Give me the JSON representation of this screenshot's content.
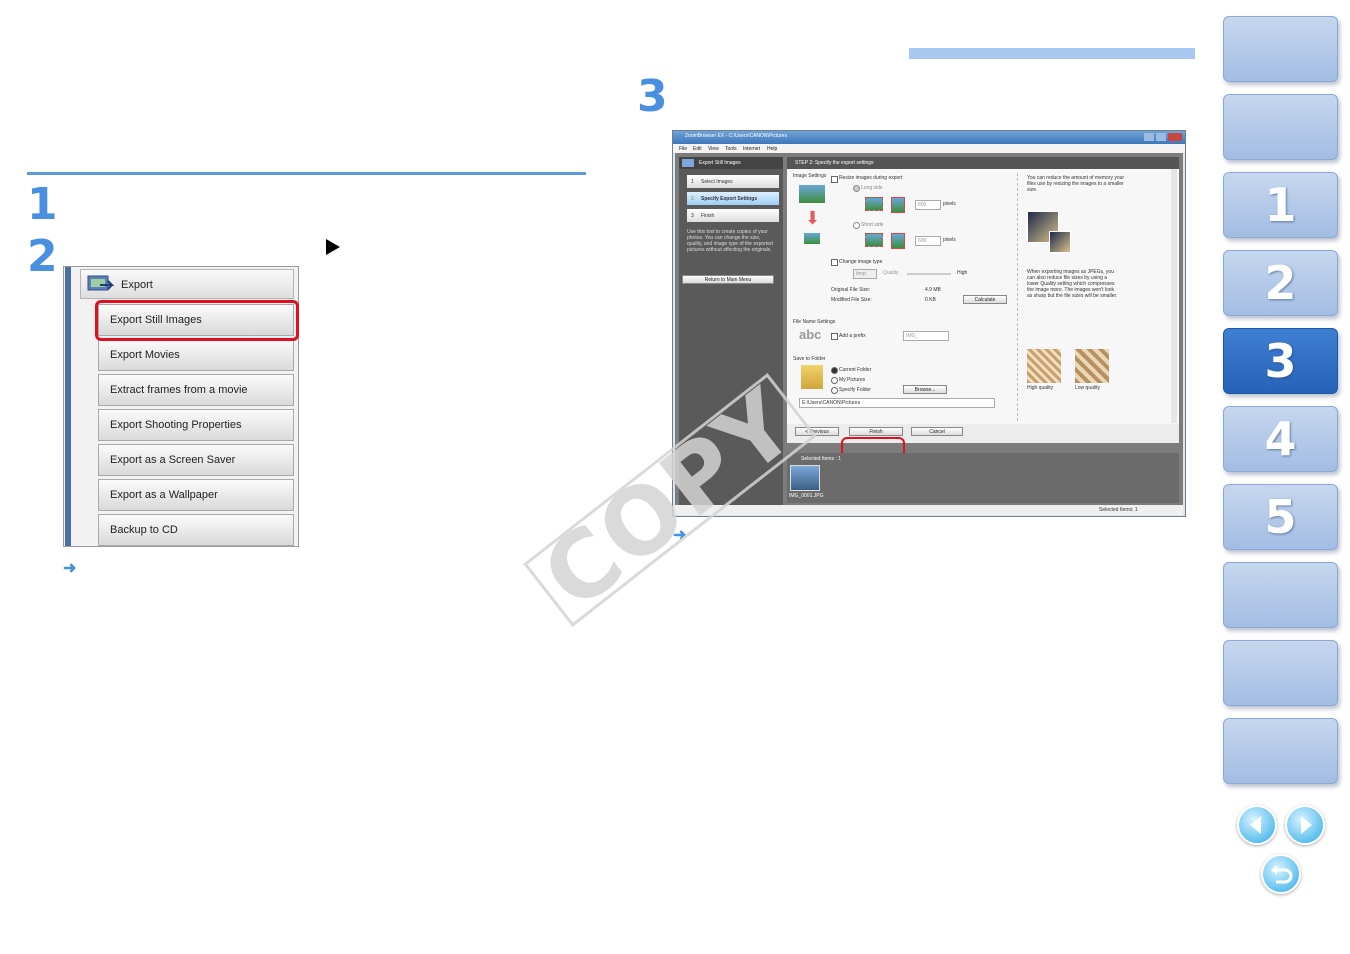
{
  "steps": {
    "one": "1",
    "two": "2",
    "three": "3"
  },
  "export_menu": {
    "header": "Export",
    "items": [
      "Export Still Images",
      "Export Movies",
      "Extract frames from a movie",
      "Export Shooting Properties",
      "Export as a Screen Saver",
      "Export as a Wallpaper",
      "Backup to CD"
    ]
  },
  "screenshot": {
    "title": "ZoomBrowser EX - C:\\Users\\CANON\\Pictures",
    "menu": [
      "File",
      "Edit",
      "View",
      "Tools",
      "Internet",
      "Help"
    ],
    "panel_title": "Export Still Images",
    "step_header": "STEP 2: Specify the export settings",
    "nav_steps": [
      "Select Images",
      "Specify Export Settings",
      "Finish"
    ],
    "nav_step_nums": [
      "1",
      "2",
      "3"
    ],
    "help_text": "Use this tool to create copies of your photos. You can change the size, quality, and image type of the exported pictures without affecting the originals.",
    "return_button": "Return to Main Menu",
    "image_settings": "Image Settings",
    "resize_label": "Resize images during export",
    "long_side": "Long side",
    "short_side": "Short side",
    "long_value": "800",
    "short_value": "600",
    "pixels": "pixels",
    "change_type": "Change image type",
    "type_value": "bmp",
    "quality_label": "Quality",
    "high_label": "High",
    "orig_size_label": "Original File Size:",
    "orig_size": "4.9 MB",
    "mod_size_label": "Modified File Size:",
    "mod_size": "0 KB",
    "calculate": "Calculate",
    "file_name_settings": "File Name Settings",
    "abc": "abc",
    "add_prefix": "Add a prefix",
    "prefix_value": "IMG_",
    "save_to_folder": "Save to Folder",
    "current_folder": "Current Folder",
    "my_pictures": "My Pictures",
    "specify_folder": "Specify Folder",
    "browse": "Browse...",
    "path": "E:\\Users\\CANON\\Pictures",
    "tip1": "You can reduce the amount of memory your files use by resizing the images to a smaller size.",
    "tip2": "When exporting images as JPEGs, you can also reduce file sizes by using a lower Quality setting which compresses the image more. The images won't look as sharp but the file sizes will be smaller.",
    "high_quality": "High quality",
    "low_quality": "Low quality",
    "previous": "< Previous",
    "finish": "Finish",
    "cancel": "Cancel",
    "selected_items": "Selected Items : 1",
    "thumb_label": "IMG_0001.JPG",
    "status": "Selected Items: 1"
  },
  "watermark": "COPY",
  "nav_tabs": [
    "",
    "",
    "1",
    "2",
    "3",
    "4",
    "5",
    "",
    "",
    ""
  ],
  "nav_active": "3",
  "colors": {
    "accent": "#4a90e0",
    "highlight": "#e01020",
    "nav_active": "#2663b8",
    "nav_inactive": "#b4c9e8"
  }
}
